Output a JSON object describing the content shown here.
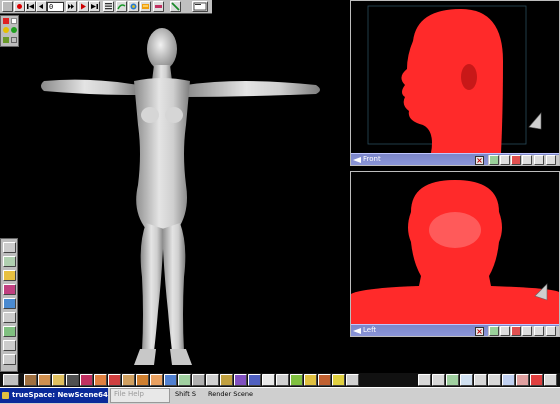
{
  "app": {
    "taskbar_title": "trueSpace: NewScene64"
  },
  "menu": {
    "file": "File",
    "help": "Help"
  },
  "status": {
    "shortcut": "Shift S",
    "action": "Render Scene"
  },
  "animation": {
    "frame": "0"
  },
  "viewports": {
    "front": {
      "label": "Front"
    },
    "left": {
      "label": "Left"
    }
  },
  "colors": {
    "background": "#000000",
    "toolbar_gray": "#c0c0c0",
    "wireframe_red": "#ff2a2a",
    "viewport_title": "#8590d4",
    "taskbar_blue": "#0a2a9a"
  },
  "icons": {
    "top_toolbar": [
      "record-icon",
      "rewind-icon",
      "prev-key-icon",
      "frame-field",
      "next-frame-icon",
      "play-icon",
      "end-icon",
      "keyframe-editor-icon",
      "path-icon",
      "brush-icon",
      "paint-object-icon",
      "spline-icon",
      "terminal-icon"
    ],
    "bottom_toolbar": [
      "object-tool-icon",
      "rotate-icon",
      "scale-icon",
      "sweep-icon",
      "mesh-icon",
      "material-icon",
      "paint-icon",
      "lathe-icon",
      "texture-icon",
      "bevel-icon",
      "boolean-icon",
      "light-icon",
      "camera-icon",
      "script-icon",
      "render-icon",
      "group-icon"
    ]
  }
}
